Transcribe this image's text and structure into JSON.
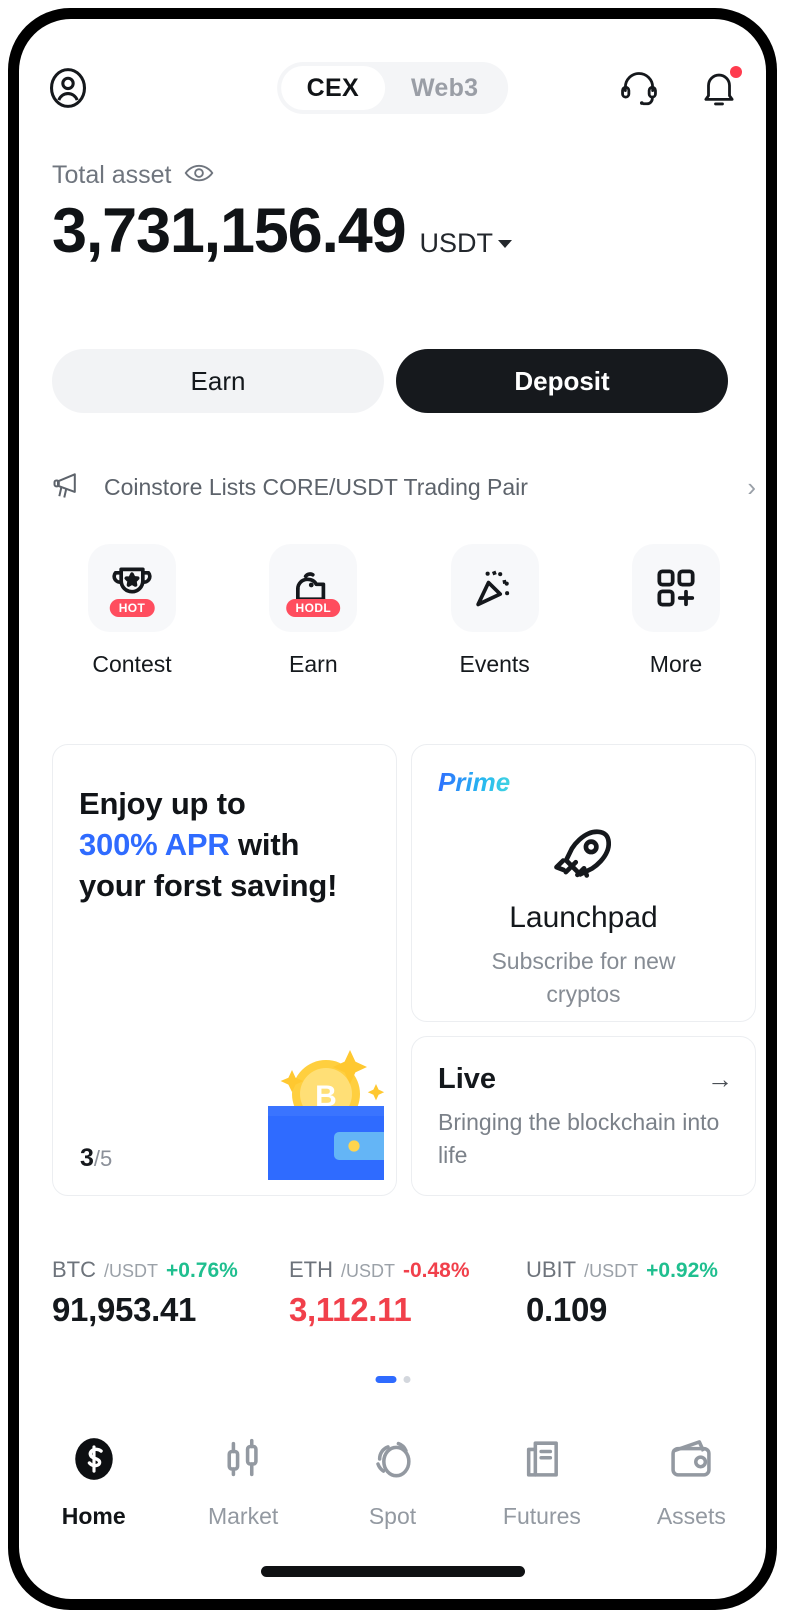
{
  "header": {
    "avatar_icon": "user-circle-icon",
    "tabs": [
      {
        "label": "CEX",
        "active": true
      },
      {
        "label": "Web3",
        "active": false
      }
    ],
    "support_icon": "headset-icon",
    "notification_icon": "bell-icon",
    "notification_dot": true
  },
  "balance": {
    "label": "Total asset",
    "eye_icon": "eye-icon",
    "amount": "3,731,156.49",
    "currency": "USDT",
    "currency_caret_icon": "caret-down-icon"
  },
  "actions": {
    "earn_label": "Earn",
    "deposit_label": "Deposit"
  },
  "announcement": {
    "icon": "megaphone-icon",
    "text": "Coinstore Lists CORE/USDT Trading Pair",
    "chevron": "›"
  },
  "quick_actions": [
    {
      "label": "Contest",
      "icon": "trophy-icon",
      "badge": "HOT"
    },
    {
      "label": "Earn",
      "icon": "piggy-savings-icon",
      "badge": "HODL"
    },
    {
      "label": "Events",
      "icon": "confetti-icon",
      "badge": ""
    },
    {
      "label": "More",
      "icon": "grid-plus-icon",
      "badge": ""
    }
  ],
  "promo": {
    "savings_card": {
      "line1": "Enjoy up to",
      "highlight": "300% APR",
      "line2_rest": " with",
      "line3": "your forst saving!",
      "highlight_color": "#2f6bff",
      "illustration": "wallet-bitcoin-icon",
      "page_current": "3",
      "page_total": "/5"
    },
    "prime_card": {
      "tag": "Prime",
      "icon": "rocket-icon",
      "title": "Launchpad",
      "subtitle": "Subscribe for new cryptos"
    },
    "live_card": {
      "title": "Live",
      "arrow_icon": "arrow-right-icon",
      "subtitle": "Bringing the blockchain into life"
    }
  },
  "tickers": [
    {
      "base": "BTC",
      "quote": "/USDT",
      "change": "+0.76%",
      "direction": "up",
      "price": "91,953.41"
    },
    {
      "base": "ETH",
      "quote": "/USDT",
      "change": "-0.48%",
      "direction": "down",
      "price": "3,112.11"
    },
    {
      "base": "UBIT",
      "quote": "/USDT",
      "change": "+0.92%",
      "direction": "up",
      "price": "0.109"
    }
  ],
  "carousel": {
    "active_index": 0,
    "total": 2,
    "active_color": "#2f6bff"
  },
  "bottom_nav": [
    {
      "label": "Home",
      "icon": "coinstore-logo-icon",
      "active": true
    },
    {
      "label": "Market",
      "icon": "candlestick-icon",
      "active": false
    },
    {
      "label": "Spot",
      "icon": "swap-circles-icon",
      "active": false
    },
    {
      "label": "Futures",
      "icon": "contract-doc-icon",
      "active": false
    },
    {
      "label": "Assets",
      "icon": "wallet-icon",
      "active": false
    }
  ]
}
